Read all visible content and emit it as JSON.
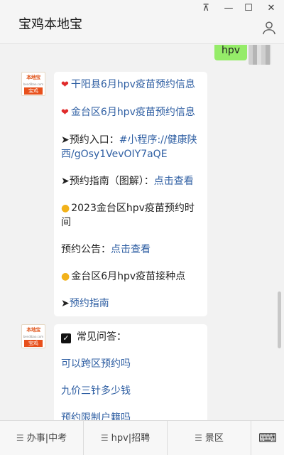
{
  "window": {
    "title": "宝鸡本地宝",
    "controls": {
      "pin": "⊼",
      "minimize": "—",
      "maximize": "☐",
      "close": "✕"
    }
  },
  "outgoing": {
    "text": "hpv"
  },
  "brand_avatar": {
    "top": "本地宝",
    "mid": "bendibao.com",
    "bottom": "宝鸡"
  },
  "message1": {
    "item1": "干阳县6月hpv疫苗预约信息",
    "item2": "金台区6月hpv疫苗预约信息",
    "entry_prefix": "➤预约入口：",
    "entry_link": "#小程序://健康陕西/gOsy1VevOIY7aQE",
    "guide_prefix": "➤预约指南（图解）：",
    "guide_link": "点击查看",
    "time_title": "2023金台区hpv疫苗预约时间",
    "notice_prefix": "预约公告：",
    "notice_link": "点击查看",
    "sites": "金台区6月hpv疫苗接种点",
    "guide2_arrow": "➤",
    "guide2_link": "预约指南"
  },
  "message2": {
    "faq_title": "常见问答：",
    "q1": "可以跨区预约吗",
    "q2": "九价三针多少钱",
    "q3": "预约限制户籍吗"
  },
  "bottom_menu": {
    "items": [
      "办事|中考",
      "hpv|招聘",
      "景区"
    ],
    "keyboard": "⌨"
  },
  "icons": [
    "heart-icon",
    "sun-icon",
    "checkbox-icon",
    "profile-icon",
    "menu-icon",
    "keyboard-icon"
  ],
  "colors": {
    "accent_link": "#2f5fa3",
    "outgoing_bubble": "#95ec69",
    "brand": "#e8501b"
  }
}
